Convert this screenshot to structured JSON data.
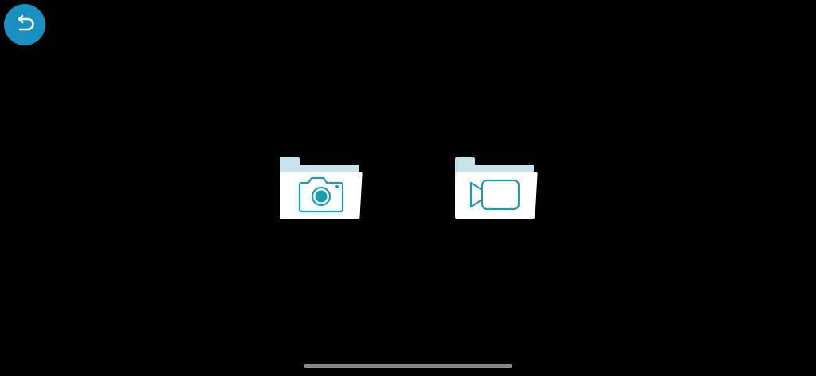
{
  "colors": {
    "background": "#000000",
    "accent": "#1a8fc2",
    "folder_tab": "#c5e3ea",
    "folder_body": "#ffffff",
    "icon_stroke": "#1b9db3",
    "home_indicator": "#8a8a8a"
  },
  "toolbar": {
    "back_icon": "back-arrow-icon"
  },
  "folders": [
    {
      "icon": "camera-icon"
    },
    {
      "icon": "video-camera-icon"
    }
  ]
}
